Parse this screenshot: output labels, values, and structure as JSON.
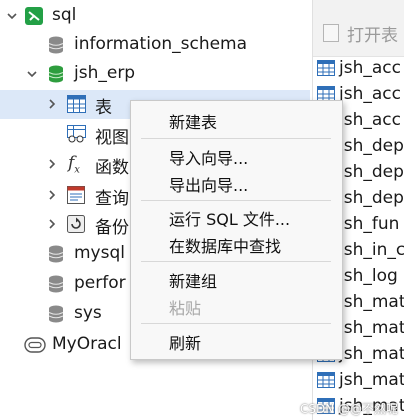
{
  "tree": {
    "connection_sql": "sql",
    "db_information_schema": "information_schema",
    "db_jsh_erp": "jsh_erp",
    "node_tables": "表",
    "node_views": "视图",
    "node_functions": "函数",
    "node_queries": "查询",
    "node_backups": "备份",
    "db_mysql": "mysql",
    "db_performance_schema": "perfor",
    "db_sys": "sys",
    "connection_oracle": "MyOracl"
  },
  "right_panel": {
    "open_tab_label": "打开表",
    "tables": [
      "jsh_acc",
      "jsh_acc",
      "jsh_acc",
      "jsh_dep",
      "jsh_dep",
      "jsh_dep",
      "jsh_fun",
      "jsh_in_c",
      "jsh_log",
      "jsh_mat",
      "jsh_mat",
      "jsh_mat",
      "jsh_mat",
      "jsh_mat"
    ]
  },
  "context_menu": {
    "new_table": "新建表",
    "import_wizard": "导入向导...",
    "export_wizard": "导出向导...",
    "run_sql_file": "运行 SQL 文件...",
    "find_in_database": "在数据库中查找",
    "new_group": "新建组",
    "paste": "粘贴",
    "refresh": "刷新"
  },
  "watermark": "CSDN @@不然呢",
  "colors": {
    "selection": "#dce8f8",
    "db_green": "#2e9d3e",
    "connection_green": "#23a046",
    "table_blue": "#2f6fb8",
    "disabled_text": "#a7a7a7"
  }
}
